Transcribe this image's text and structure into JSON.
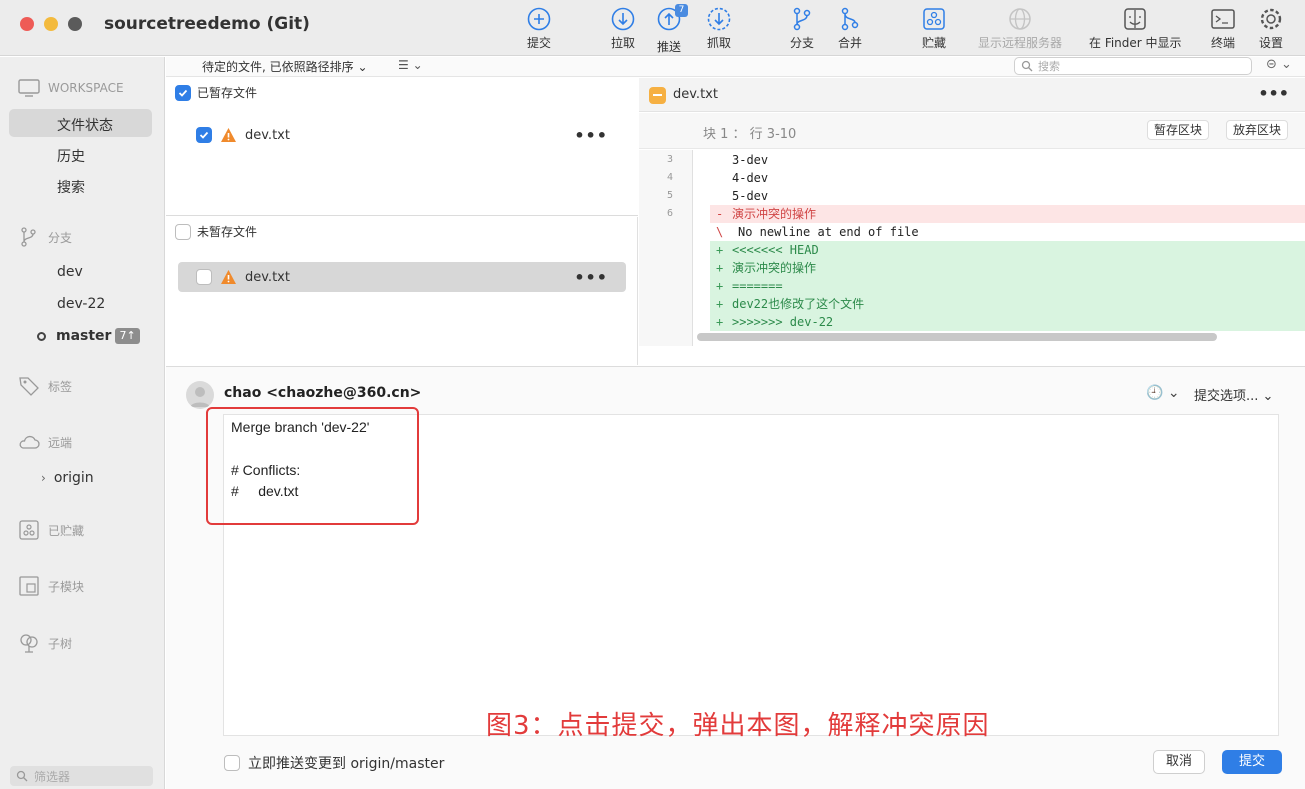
{
  "window": {
    "title": "sourcetreedemo (Git)"
  },
  "toolbar": [
    {
      "id": "commit",
      "label": "提交",
      "icon": "commit-plus-icon"
    },
    {
      "id": "pull",
      "label": "拉取",
      "icon": "pull-down-icon"
    },
    {
      "id": "push",
      "label": "推送",
      "icon": "push-up-icon",
      "badge": "7"
    },
    {
      "id": "fetch",
      "label": "抓取",
      "icon": "fetch-icon"
    },
    {
      "id": "branch",
      "label": "分支",
      "icon": "branch-icon"
    },
    {
      "id": "merge",
      "label": "合并",
      "icon": "merge-icon"
    },
    {
      "id": "stash",
      "label": "贮藏",
      "icon": "stash-icon"
    },
    {
      "id": "remote",
      "label": "显示远程服务器",
      "icon": "globe-icon",
      "disabled": true
    },
    {
      "id": "finder",
      "label": "在 Finder 中显示",
      "icon": "finder-icon"
    },
    {
      "id": "terminal",
      "label": "终端",
      "icon": "terminal-icon"
    },
    {
      "id": "settings",
      "label": "设置",
      "icon": "gear-icon"
    }
  ],
  "sidebar": {
    "workspace": "WORKSPACE",
    "workspace_items": [
      "文件状态",
      "历史",
      "搜索"
    ],
    "branches_label": "分支",
    "branches": [
      "dev",
      "dev-22",
      "master"
    ],
    "master_badge": "7↑",
    "tags_label": "标签",
    "remotes_label": "远端",
    "remote_item": "origin",
    "stashes_label": "已贮藏",
    "submodules_label": "子模块",
    "subtrees_label": "子树",
    "filter_placeholder": "筛选器"
  },
  "sortbar": {
    "label": "待定的文件, 已依照路径排序",
    "search_placeholder": "搜索"
  },
  "staged": {
    "title": "已暂存文件",
    "files": [
      {
        "name": "dev.txt"
      }
    ]
  },
  "unstaged": {
    "title": "未暂存文件",
    "files": [
      {
        "name": "dev.txt"
      }
    ]
  },
  "diff": {
    "file": "dev.txt",
    "hunk_label": "块 1 ： 行 3-10",
    "stage_hunk": "暂存区块",
    "discard_hunk": "放弃区块",
    "lines": [
      {
        "num": "3",
        "type": "ctx",
        "sign": "",
        "text": "3-dev"
      },
      {
        "num": "4",
        "type": "ctx",
        "sign": "",
        "text": "4-dev"
      },
      {
        "num": "5",
        "type": "ctx",
        "sign": "",
        "text": "5-dev"
      },
      {
        "num": "6",
        "type": "rem",
        "sign": "-",
        "text": "演示冲突的操作"
      },
      {
        "num": "",
        "type": "noeol",
        "sign": "\\",
        "text": "No newline at end of file"
      },
      {
        "num": "",
        "type": "add",
        "sign": "+",
        "text": "<<<<<<< HEAD"
      },
      {
        "num": "",
        "type": "add",
        "sign": "+",
        "text": "演示冲突的操作"
      },
      {
        "num": "",
        "type": "add",
        "sign": "+",
        "text": "======="
      },
      {
        "num": "",
        "type": "add",
        "sign": "+",
        "text": "dev22也修改了这个文件"
      },
      {
        "num": "",
        "type": "add",
        "sign": "+",
        "text": ">>>>>>> dev-22"
      }
    ]
  },
  "commit": {
    "author": "chao <chaozhe@360.cn>",
    "options_label": "提交选项...",
    "message_lines": [
      "Merge branch 'dev-22'",
      "",
      "# Conflicts:",
      "#     dev.txt"
    ],
    "annotation": "图3：点击提交，弹出本图，解释冲突原因",
    "push_label": "立即推送变更到 origin/master",
    "cancel_label": "取消",
    "commit_label": "提交"
  },
  "colors": {
    "accent": "#2f7ee6",
    "warning": "#f08a2c",
    "annotation": "#e23b3b",
    "added_bg": "#d9f4e0",
    "removed_bg": "#fde5e5"
  }
}
